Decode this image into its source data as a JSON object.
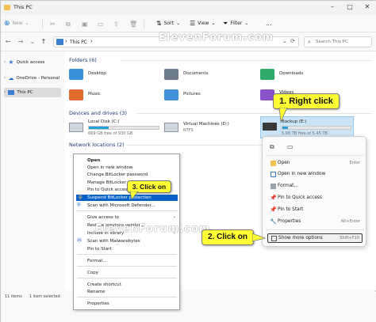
{
  "window": {
    "title": "This PC"
  },
  "toolbar": {
    "new_label": "New",
    "sort_label": "Sort",
    "view_label": "View",
    "filter_label": "Filter",
    "more_label": "..."
  },
  "address": {
    "path_root": "›",
    "path": "This PC",
    "path_chevron": "›",
    "search_placeholder": "Search This PC"
  },
  "sidebar": {
    "items": [
      {
        "label": "Quick access",
        "icon": "star-icon"
      },
      {
        "label": "OneDrive - Personal",
        "icon": "cloud-icon"
      },
      {
        "label": "This PC",
        "icon": "pc-icon"
      }
    ]
  },
  "main": {
    "folders_header": "Folders (6)",
    "folders": [
      {
        "label": "Desktop",
        "icon": "desktop-folder-icon",
        "color": "#3a8fd9"
      },
      {
        "label": "Documents",
        "icon": "documents-folder-icon",
        "color": "#6d7a8a"
      },
      {
        "label": "Downloads",
        "icon": "downloads-folder-icon",
        "color": "#2faa6a"
      },
      {
        "label": "Music",
        "icon": "music-folder-icon",
        "color": "#e36b2c"
      },
      {
        "label": "Pictures",
        "icon": "pictures-folder-icon",
        "color": "#3f8fd9"
      },
      {
        "label": "Videos",
        "icon": "videos-folder-icon",
        "color": "#8a52c7"
      }
    ],
    "drives_header": "Devices and drives (3)",
    "drives": [
      {
        "label": "Local Disk (C:)",
        "sub": "669 GB free of 930 GB",
        "used_fraction": 0.28
      },
      {
        "label": "Virtual Machines (D:)",
        "sub": "NTFS",
        "used_fraction": null
      },
      {
        "label": "Backup (E:)",
        "sub": "5.00 TB free of 5.45 TB",
        "used_fraction": 0.08
      }
    ],
    "network_header": "Network locations (2)"
  },
  "status": {
    "items_count": "11 items",
    "selected": "1 item selected"
  },
  "old_menu": {
    "items": [
      "Open",
      "Open in new window",
      "Change BitLocker password",
      "Manage BitLocker",
      "Pin to Quick access",
      "Suspend BitLocker protection",
      "Scan with Microsoft Defender...",
      "Give access to",
      "Restore previous versions",
      "Include in library",
      "Scan with Malwarebytes",
      "Pin to Start",
      "Format...",
      "Copy",
      "Create shortcut",
      "Rename",
      "Properties"
    ]
  },
  "new_menu": {
    "items": [
      {
        "label": "Open",
        "shortcut": "Enter"
      },
      {
        "label": "Open in new window",
        "shortcut": ""
      },
      {
        "label": "Format...",
        "shortcut": ""
      },
      {
        "label": "Pin to Quick access",
        "shortcut": ""
      },
      {
        "label": "Pin to Start",
        "shortcut": ""
      },
      {
        "label": "Properties",
        "shortcut": "Alt+Enter"
      },
      {
        "label": "Show more options",
        "shortcut": "Shift+F10"
      }
    ]
  },
  "callouts": {
    "right_click": "1. Right click",
    "click_on_2": "2. Click on",
    "click_on_3": "3. Click on"
  },
  "watermark": {
    "text_top": "ElevenForum.com",
    "text_bottom": "ElevenForum.com"
  },
  "colors": {
    "accent": "#0a62c7",
    "drive_bar": "#26a0da",
    "callout": "#ffff33"
  }
}
